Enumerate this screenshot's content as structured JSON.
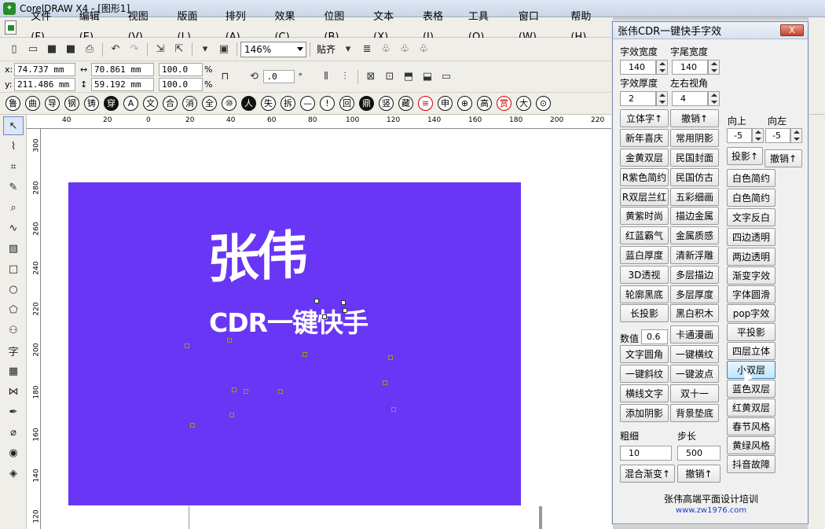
{
  "window": {
    "title": "CorelDRAW X4 - [图形1]"
  },
  "menu": [
    "文件(F)",
    "编辑(E)",
    "视图(V)",
    "版面(L)",
    "排列(A)",
    "效果(C)",
    "位图(B)",
    "文本(X)",
    "表格(I)",
    "工具(O)",
    "窗口(W)",
    "帮助(H)"
  ],
  "toolbar": {
    "zoom": "146%",
    "snap": "贴齐"
  },
  "property_bar": {
    "x": "74.737 mm",
    "y": "211.486 mm",
    "width": "70.861 mm",
    "height": "59.192 mm",
    "scale_x": "100.0",
    "scale_y": "100.0",
    "pct": "%",
    "rotation": ".0",
    "deg": "°",
    "x_label": "x:",
    "y_label": "y:"
  },
  "glyph_row": [
    "鲁",
    "曲",
    "导",
    "钢",
    "铸",
    "穿",
    "A",
    "文",
    "合",
    "消",
    "全",
    "⑩",
    "人",
    "失",
    "拆",
    "—",
    "!",
    "回",
    "鼎",
    "竖",
    "藏",
    "≡",
    "申",
    "⊕",
    "高",
    "赏",
    "大",
    "⊙"
  ],
  "rulers": {
    "h": [
      "40",
      "20",
      "0",
      "20",
      "40",
      "60",
      "80",
      "100",
      "120",
      "140",
      "160",
      "180",
      "200",
      "220"
    ],
    "v": [
      "300",
      "280",
      "260",
      "240",
      "220",
      "200",
      "180",
      "160",
      "140",
      "120"
    ]
  },
  "artwork": {
    "title": "张伟",
    "subtitle": "CDR一键快手",
    "bg": "#6936f5"
  },
  "panel": {
    "title": "张伟CDR一键快手字效",
    "close": "X",
    "labels": {
      "char_width": "字效宽度",
      "tail_width": "字尾宽度",
      "thickness": "字效厚度",
      "view_angle": "左右视角",
      "up": "向上",
      "left": "向左",
      "value": "数值",
      "coarse": "粗细",
      "step": "步长"
    },
    "values": {
      "char_width": "140",
      "tail_width": "140",
      "thickness": "2",
      "view_angle": "4",
      "up": "-5",
      "left": "-5",
      "value": "0.6",
      "coarse": "10",
      "step": "500"
    },
    "buttons_left": [
      "立体字↑",
      "新年喜庆",
      "金黄双层",
      "R紫色简约",
      "R双层兰红",
      "黄紫时尚",
      "红蓝霸气",
      "蓝白厚度",
      "3D透视",
      "轮廓黑底",
      "长投影"
    ],
    "buttons_mid": [
      "撤销↑",
      "常用阴影",
      "民国封面",
      "民国仿古",
      "五彩细画",
      "描边金属",
      "金属质感",
      "清新浮雕",
      "多层描边",
      "多层厚度",
      "黑白积木"
    ],
    "buttons_lower_left": [
      "文字圆角",
      "一键斜纹",
      "横线文字",
      "添加阴影"
    ],
    "buttons_lower_mid": [
      "卡通漫画",
      "一键横纹",
      "一键波点",
      "双十一",
      "背景垫底"
    ],
    "buttons_right_top": [
      "投影↑",
      "撤销↑"
    ],
    "buttons_right": [
      "白色简约",
      "白色简约",
      "文字反白",
      "四边透明",
      "两边透明",
      "渐变字效",
      "字体圆滑",
      "pop字效",
      "平投影",
      "四层立体",
      "小双层",
      "蓝色双层",
      "红黄双层",
      "春节风格",
      "黄绿风格",
      "抖音故障"
    ],
    "blend": "混合渐变↑",
    "undo": "撤销↑",
    "credit": "张伟高端平面设计培训",
    "url": "www.zw1976.com"
  }
}
